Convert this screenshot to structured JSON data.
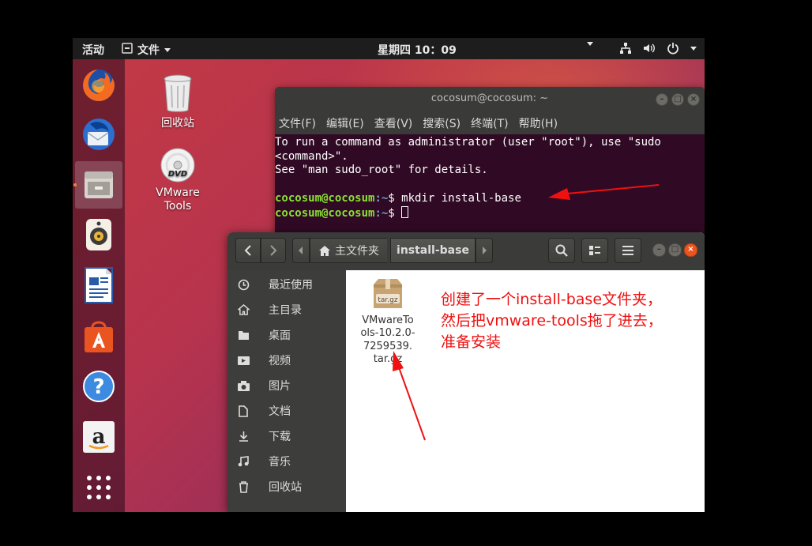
{
  "topbar": {
    "activities": "活动",
    "app_menu": "文件",
    "clock": "星期四 10：09",
    "icons": [
      "network-icon",
      "volume-icon",
      "power-icon"
    ]
  },
  "dock": {
    "items": [
      "firefox-icon",
      "thunderbird-icon",
      "files-icon",
      "rhythmbox-icon",
      "writer-icon",
      "software-center-icon",
      "help-icon",
      "amazon-icon",
      "show-apps-icon"
    ]
  },
  "desktop": {
    "trash_label": "回收站",
    "vmware_label_1": "VMware",
    "vmware_label_2": "Tools",
    "dvd_text": "DVD"
  },
  "terminal": {
    "title": "cocosum@cocosum: ~",
    "menu": [
      "文件(F)",
      "编辑(E)",
      "查看(V)",
      "搜索(S)",
      "终端(T)",
      "帮助(H)"
    ],
    "line1": "To run a command as administrator (user \"root\"), use \"sudo",
    "line2": "<command>\".",
    "line3": "See \"man sudo_root\" for details.",
    "prompt_user": "cocosum@cocosum",
    "prompt_path": ":~",
    "prompt_sign": "$ ",
    "command": "mkdir install-base"
  },
  "files": {
    "path_home": "主文件夹",
    "path_current": "install-base",
    "sidebar": [
      "最近使用",
      "主目录",
      "桌面",
      "视频",
      "图片",
      "文档",
      "下载",
      "音乐",
      "回收站"
    ],
    "file_badge": "tar.gz",
    "file_name_lines": [
      "VMwareTo",
      "ols-10.2.0-",
      "7259539.",
      "tar.gz"
    ],
    "annotation": "创建了一个install-base文件夹，\n然后把vmware-tools拖了进去，\n准备安装"
  },
  "colors": {
    "terminal_bg": "#300a24",
    "prompt_user": "#8ae234",
    "prompt_path": "#729fcf",
    "annotation": "#f01010",
    "close_button": "#e95420"
  }
}
